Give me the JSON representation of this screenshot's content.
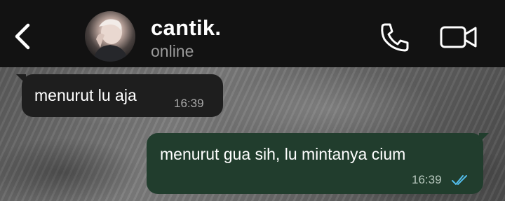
{
  "header": {
    "contact_name": "cantik.",
    "status": "online",
    "icons": {
      "back": "chevron-left-icon",
      "call": "phone-icon",
      "video": "video-camera-icon"
    }
  },
  "messages": [
    {
      "direction": "incoming",
      "text": "menurut lu aja",
      "time": "16:39"
    },
    {
      "direction": "outgoing",
      "text": "menurut gua sih, lu mintanya cium",
      "time": "16:39",
      "status": "read"
    }
  ],
  "colors": {
    "header_bg": "#121212",
    "incoming_bubble": "#1e1e1e",
    "outgoing_bubble": "#213d2d",
    "read_tick": "#53bdeb"
  }
}
